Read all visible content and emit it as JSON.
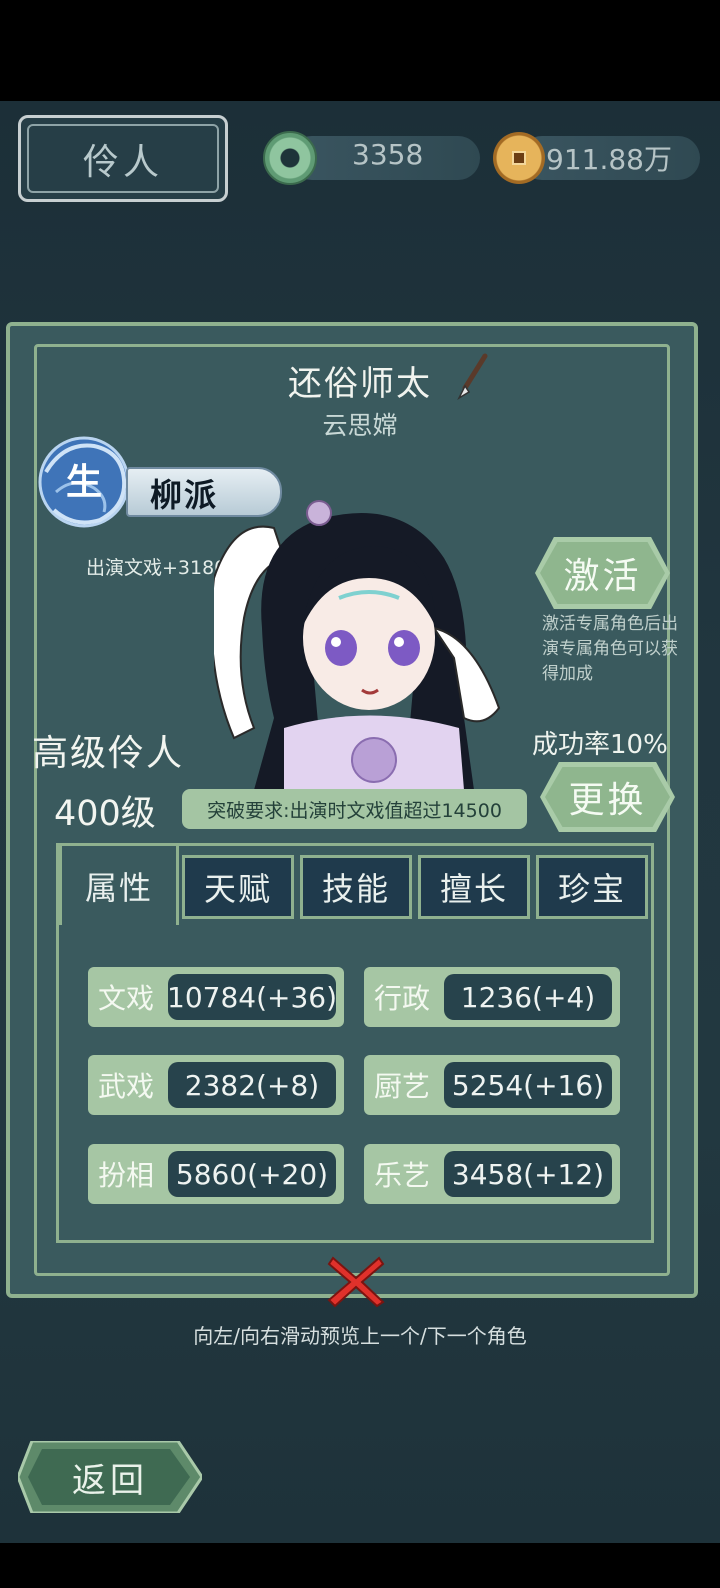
{
  "header": {
    "title": "伶人",
    "jade_value": "3358",
    "coin_value": "911.88万"
  },
  "character": {
    "name": "还俗师太",
    "performer": "云思嫦",
    "faction": "柳派",
    "faction_role_glyph": "生",
    "performance_bonus": "出演文戏+3180",
    "rank_title": "高级伶人",
    "level": "400级",
    "breakthrough_requirement": "突破要求:出演时文戏值超过14500"
  },
  "actions": {
    "activate_label": "激活",
    "activate_desc": "激活专属角色后出演专属角色可以获得加成",
    "success_rate": "成功率10%",
    "replace_label": "更换"
  },
  "tabs": [
    {
      "label": "属性",
      "active": true
    },
    {
      "label": "天赋",
      "active": false
    },
    {
      "label": "技能",
      "active": false
    },
    {
      "label": "擅长",
      "active": false
    },
    {
      "label": "珍宝",
      "active": false
    }
  ],
  "stats": [
    {
      "label": "文戏",
      "value": "10784(+36)"
    },
    {
      "label": "行政",
      "value": "1236(+4)"
    },
    {
      "label": "武戏",
      "value": "2382(+8)"
    },
    {
      "label": "厨艺",
      "value": "5254(+16)"
    },
    {
      "label": "扮相",
      "value": "5860(+20)"
    },
    {
      "label": "乐艺",
      "value": "3458(+12)"
    }
  ],
  "hint": "向左/向右滑动预览上一个/下一个角色",
  "back_label": "返回",
  "colors": {
    "panel": "#3a5a5e",
    "accent_green": "#a6c6a4",
    "dark_value_bg": "#27434c"
  }
}
